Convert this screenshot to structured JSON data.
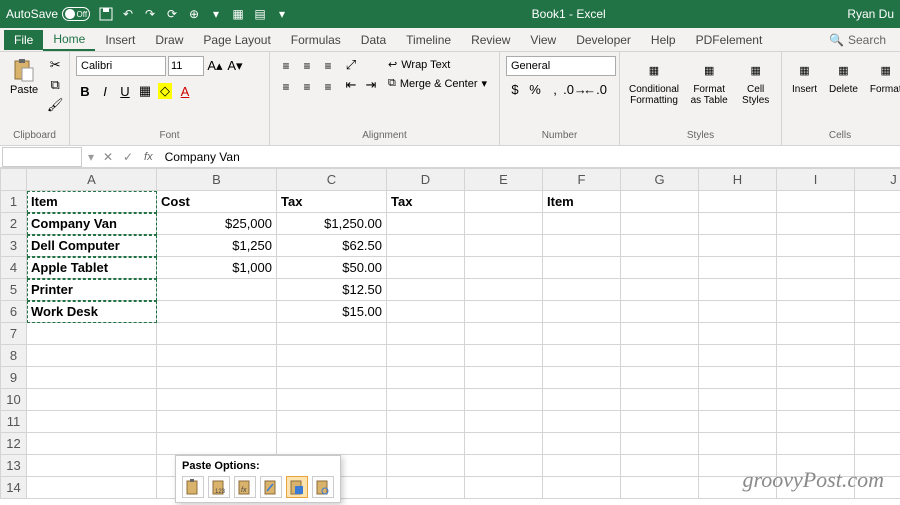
{
  "titlebar": {
    "autosave_label": "AutoSave",
    "autosave_state": "Off",
    "title": "Book1 - Excel",
    "user": "Ryan Du"
  },
  "menu": {
    "items": [
      "File",
      "Home",
      "Insert",
      "Draw",
      "Page Layout",
      "Formulas",
      "Data",
      "Timeline",
      "Review",
      "View",
      "Developer",
      "Help",
      "PDFelement"
    ],
    "active": "Home",
    "search_label": "Search"
  },
  "ribbon": {
    "clipboard": {
      "label": "Clipboard",
      "paste": "Paste"
    },
    "font": {
      "label": "Font",
      "name": "Calibri",
      "size": "11",
      "bold": "B",
      "italic": "I",
      "underline": "U"
    },
    "alignment": {
      "label": "Alignment",
      "wrap": "Wrap Text",
      "merge": "Merge & Center"
    },
    "number": {
      "label": "Number",
      "format": "General"
    },
    "styles": {
      "label": "Styles",
      "cond": "Conditional Formatting",
      "table": "Format as Table",
      "cell": "Cell Styles"
    },
    "cells": {
      "label": "Cells",
      "insert": "Insert",
      "delete": "Delete",
      "format": "Format"
    }
  },
  "formulabar": {
    "namebox": "",
    "value": "Company Van"
  },
  "columns": [
    "A",
    "B",
    "C",
    "D",
    "E",
    "F",
    "G",
    "H",
    "I",
    "J"
  ],
  "rows_shown": 14,
  "data": {
    "r1": {
      "A": "Item",
      "B": "Cost",
      "C": "Tax",
      "D": "Tax",
      "F": "Item"
    },
    "r2": {
      "A": "Company Van",
      "B": "$25,000",
      "C": "$1,250.00"
    },
    "r3": {
      "A": "Dell Computer",
      "B": "$1,250",
      "C": "$62.50"
    },
    "r4": {
      "A": "Apple Tablet",
      "B": "$1,000",
      "C": "$50.00"
    },
    "r5": {
      "A": "Printer",
      "C": "$12.50"
    },
    "r6": {
      "A": "Work Desk",
      "C": "$15.00"
    }
  },
  "paste_popup": {
    "title": "Paste Options:",
    "options": [
      "paste",
      "paste-values",
      "paste-formulas",
      "paste-transpose",
      "paste-formatting",
      "paste-link"
    ]
  },
  "watermark": "groovyPost.com"
}
